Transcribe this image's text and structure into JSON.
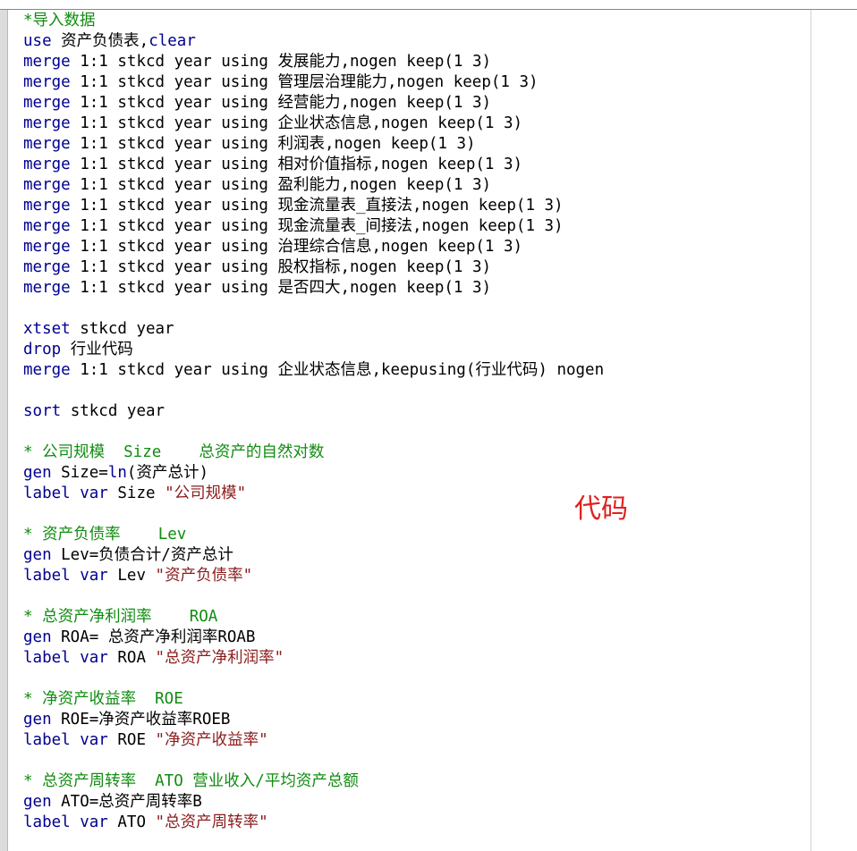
{
  "colors": {
    "keyword": "#000090",
    "comment": "#118c11",
    "string": "#8b1c1c",
    "text": "#000000",
    "annotation": "#e02020"
  },
  "annotation_label": "代码",
  "lines": [
    [
      {
        "t": "*导入数据",
        "c": "cm"
      }
    ],
    [
      {
        "t": "use",
        "c": "kw"
      },
      {
        "t": " 资产负债表,"
      },
      {
        "t": "clear",
        "c": "kw"
      }
    ],
    [
      {
        "t": "merge",
        "c": "kw"
      },
      {
        "t": " 1:1 stkcd year using 发展能力,nogen keep(1 3)"
      }
    ],
    [
      {
        "t": "merge",
        "c": "kw"
      },
      {
        "t": " 1:1 stkcd year using 管理层治理能力,nogen keep(1 3)"
      }
    ],
    [
      {
        "t": "merge",
        "c": "kw"
      },
      {
        "t": " 1:1 stkcd year using 经营能力,nogen keep(1 3)"
      }
    ],
    [
      {
        "t": "merge",
        "c": "kw"
      },
      {
        "t": " 1:1 stkcd year using 企业状态信息,nogen keep(1 3)"
      }
    ],
    [
      {
        "t": "merge",
        "c": "kw"
      },
      {
        "t": " 1:1 stkcd year using 利润表,nogen keep(1 3)"
      }
    ],
    [
      {
        "t": "merge",
        "c": "kw"
      },
      {
        "t": " 1:1 stkcd year using 相对价值指标,nogen keep(1 3)"
      }
    ],
    [
      {
        "t": "merge",
        "c": "kw"
      },
      {
        "t": " 1:1 stkcd year using 盈利能力,nogen keep(1 3)"
      }
    ],
    [
      {
        "t": "merge",
        "c": "kw"
      },
      {
        "t": " 1:1 stkcd year using 现金流量表_直接法,nogen keep(1 3)"
      }
    ],
    [
      {
        "t": "merge",
        "c": "kw"
      },
      {
        "t": " 1:1 stkcd year using 现金流量表_间接法,nogen keep(1 3)"
      }
    ],
    [
      {
        "t": "merge",
        "c": "kw"
      },
      {
        "t": " 1:1 stkcd year using 治理综合信息,nogen keep(1 3)"
      }
    ],
    [
      {
        "t": "merge",
        "c": "kw"
      },
      {
        "t": " 1:1 stkcd year using 股权指标,nogen keep(1 3)"
      }
    ],
    [
      {
        "t": "merge",
        "c": "kw"
      },
      {
        "t": " 1:1 stkcd year using 是否四大,nogen keep(1 3)"
      }
    ],
    [],
    [
      {
        "t": "xtset",
        "c": "kw"
      },
      {
        "t": " stkcd year"
      }
    ],
    [
      {
        "t": "drop",
        "c": "kw"
      },
      {
        "t": " 行业代码"
      }
    ],
    [
      {
        "t": "merge",
        "c": "kw"
      },
      {
        "t": " 1:1 stkcd year using 企业状态信息,keepusing(行业代码) nogen"
      }
    ],
    [],
    [
      {
        "t": "sort",
        "c": "kw"
      },
      {
        "t": " stkcd year"
      }
    ],
    [],
    [
      {
        "t": "* 公司规模  Size    总资产的自然对数",
        "c": "cm"
      }
    ],
    [
      {
        "t": "gen",
        "c": "kw"
      },
      {
        "t": " Size="
      },
      {
        "t": "ln",
        "c": "kw"
      },
      {
        "t": "(资产总计)"
      }
    ],
    [
      {
        "t": "label",
        "c": "kw"
      },
      {
        "t": " "
      },
      {
        "t": "var",
        "c": "kw"
      },
      {
        "t": " Size "
      },
      {
        "t": "\"公司规模\"",
        "c": "st"
      }
    ],
    [],
    [
      {
        "t": "* 资产负债率    Lev",
        "c": "cm"
      }
    ],
    [
      {
        "t": "gen",
        "c": "kw"
      },
      {
        "t": " Lev=负债合计/资产总计"
      }
    ],
    [
      {
        "t": "label",
        "c": "kw"
      },
      {
        "t": " "
      },
      {
        "t": "var",
        "c": "kw"
      },
      {
        "t": " Lev "
      },
      {
        "t": "\"资产负债率\"",
        "c": "st"
      }
    ],
    [],
    [
      {
        "t": "* 总资产净利润率    ROA",
        "c": "cm"
      }
    ],
    [
      {
        "t": "gen",
        "c": "kw"
      },
      {
        "t": " ROA= 总资产净利润率ROAB"
      }
    ],
    [
      {
        "t": "label",
        "c": "kw"
      },
      {
        "t": " "
      },
      {
        "t": "var",
        "c": "kw"
      },
      {
        "t": " ROA "
      },
      {
        "t": "\"总资产净利润率\"",
        "c": "st"
      }
    ],
    [],
    [
      {
        "t": "* 净资产收益率  ROE",
        "c": "cm"
      }
    ],
    [
      {
        "t": "gen",
        "c": "kw"
      },
      {
        "t": " ROE=净资产收益率ROEB"
      }
    ],
    [
      {
        "t": "label",
        "c": "kw"
      },
      {
        "t": " "
      },
      {
        "t": "var",
        "c": "kw"
      },
      {
        "t": " ROE "
      },
      {
        "t": "\"净资产收益率\"",
        "c": "st"
      }
    ],
    [],
    [
      {
        "t": "* 总资产周转率  ATO 营业收入/平均资产总额",
        "c": "cm"
      }
    ],
    [
      {
        "t": "gen",
        "c": "kw"
      },
      {
        "t": " ATO=总资产周转率B"
      }
    ],
    [
      {
        "t": "label",
        "c": "kw"
      },
      {
        "t": " "
      },
      {
        "t": "var",
        "c": "kw"
      },
      {
        "t": " ATO "
      },
      {
        "t": "\"总资产周转率\"",
        "c": "st"
      }
    ]
  ]
}
